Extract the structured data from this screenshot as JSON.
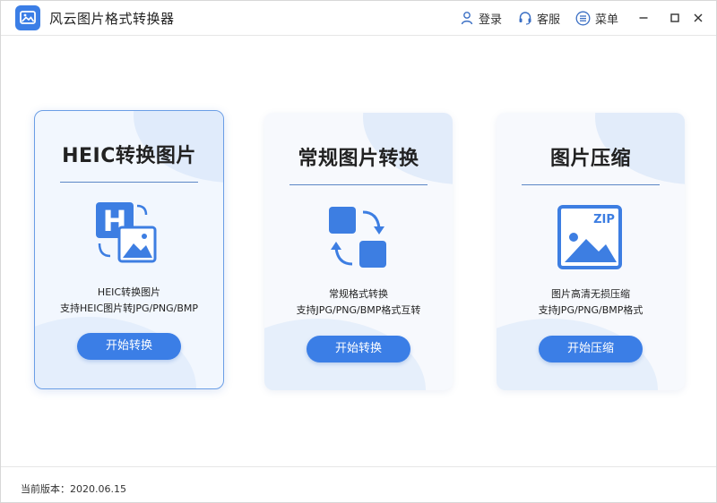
{
  "app": {
    "title": "风云图片格式转换器"
  },
  "toolbar": {
    "login_label": "登录",
    "support_label": "客服",
    "menu_label": "菜单"
  },
  "cards": [
    {
      "title": "HEIC转换图片",
      "desc_line1": "HEIC转换图片",
      "desc_line2": "支持HEIC图片转JPG/PNG/BMP",
      "button_label": "开始转换",
      "icon": "heic-image-icon",
      "active": true
    },
    {
      "title": "常规图片转换",
      "desc_line1": "常规格式转换",
      "desc_line2": "支持JPG/PNG/BMP格式互转",
      "button_label": "开始转换",
      "icon": "convert-arrows-icon",
      "active": false
    },
    {
      "title": "图片压缩",
      "desc_line1": "图片高清无损压缩",
      "desc_line2": "支持JPG/PNG/BMP格式",
      "button_label": "开始压缩",
      "icon": "zip-image-icon",
      "zip_text": "ZIP",
      "active": false
    }
  ],
  "footer": {
    "version": "当前版本：2020.06.15"
  },
  "colors": {
    "accent": "#3b7ee6",
    "icon_blue": "#3d7ee2",
    "card_bg": "#f7f9fd"
  }
}
